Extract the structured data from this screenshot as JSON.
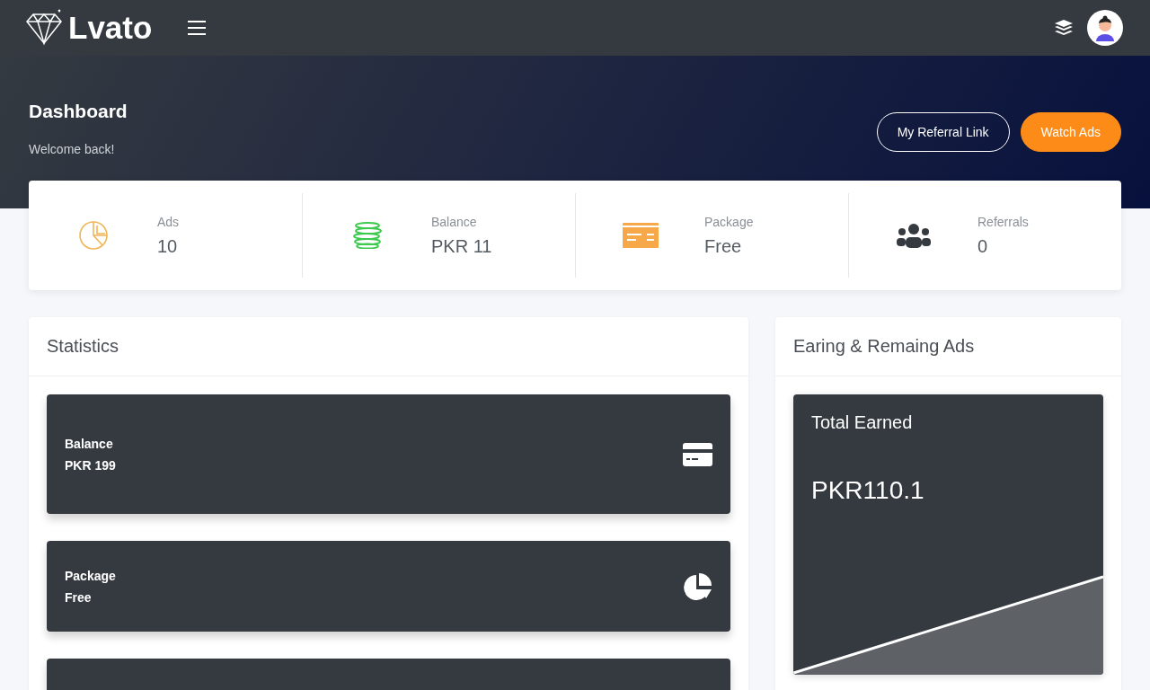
{
  "brand": {
    "name": "Lvato"
  },
  "header": {
    "title": "Dashboard",
    "subtitle": "Welcome back!",
    "buttons": [
      {
        "label": "My Referral Link",
        "kind": "outline"
      },
      {
        "label": "Watch Ads",
        "kind": "primary"
      }
    ]
  },
  "stats": [
    {
      "label": "Ads",
      "value": "10"
    },
    {
      "label": "Balance",
      "value": "PKR 11"
    },
    {
      "label": "Package",
      "value": "Free"
    },
    {
      "label": "Referrals",
      "value": "0"
    }
  ],
  "statistics": {
    "title": "Statistics",
    "cards": [
      {
        "label": "Balance",
        "value": "PKR 199"
      },
      {
        "label": "Package",
        "value": "Free"
      }
    ]
  },
  "earnings": {
    "title": "Earing & Remaing Ads",
    "card_title": "Total Earned",
    "amount": "PKR110.1"
  }
}
